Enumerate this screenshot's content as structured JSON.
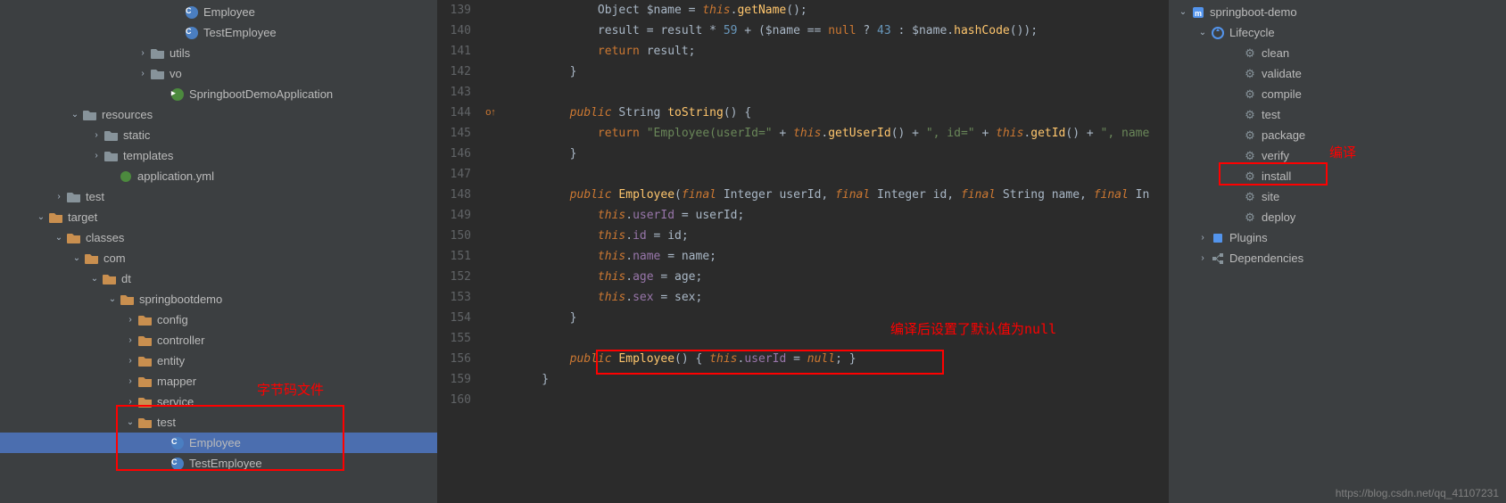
{
  "projectTree": [
    {
      "indent": 190,
      "arrow": "",
      "icon": "class-c",
      "label": "Employee"
    },
    {
      "indent": 190,
      "arrow": "",
      "icon": "class-c",
      "label": "TestEmployee"
    },
    {
      "indent": 152,
      "arrow": "›",
      "icon": "folder",
      "label": "utils"
    },
    {
      "indent": 152,
      "arrow": "›",
      "icon": "folder",
      "label": "vo"
    },
    {
      "indent": 174,
      "arrow": "",
      "icon": "class-g",
      "label": "SpringbootDemoApplication"
    },
    {
      "indent": 76,
      "arrow": "⌄",
      "icon": "folder-res",
      "label": "resources"
    },
    {
      "indent": 100,
      "arrow": "›",
      "icon": "folder",
      "label": "static"
    },
    {
      "indent": 100,
      "arrow": "›",
      "icon": "folder",
      "label": "templates"
    },
    {
      "indent": 116,
      "arrow": "",
      "icon": "yml",
      "label": "application.yml"
    },
    {
      "indent": 58,
      "arrow": "›",
      "icon": "folder",
      "label": "test"
    },
    {
      "indent": 38,
      "arrow": "⌄",
      "icon": "folder-orange",
      "label": "target"
    },
    {
      "indent": 58,
      "arrow": "⌄",
      "icon": "folder-orange",
      "label": "classes"
    },
    {
      "indent": 78,
      "arrow": "⌄",
      "icon": "folder-orange",
      "label": "com"
    },
    {
      "indent": 98,
      "arrow": "⌄",
      "icon": "folder-orange",
      "label": "dt"
    },
    {
      "indent": 118,
      "arrow": "⌄",
      "icon": "folder-orange",
      "label": "springbootdemo"
    },
    {
      "indent": 138,
      "arrow": "›",
      "icon": "folder-orange",
      "label": "config"
    },
    {
      "indent": 138,
      "arrow": "›",
      "icon": "folder-orange",
      "label": "controller"
    },
    {
      "indent": 138,
      "arrow": "›",
      "icon": "folder-orange",
      "label": "entity"
    },
    {
      "indent": 138,
      "arrow": "›",
      "icon": "folder-orange",
      "label": "mapper"
    },
    {
      "indent": 138,
      "arrow": "›",
      "icon": "folder-orange",
      "label": "service"
    },
    {
      "indent": 138,
      "arrow": "⌄",
      "icon": "folder-orange",
      "label": "test"
    },
    {
      "indent": 174,
      "arrow": "",
      "icon": "class-c",
      "label": "Employee",
      "selected": true
    },
    {
      "indent": 174,
      "arrow": "",
      "icon": "class-c",
      "label": "TestEmployee"
    }
  ],
  "code": {
    "lines": [
      {
        "num": "139",
        "tokens": [
          {
            "t": "            Object $name = ",
            "c": ""
          },
          {
            "t": "this",
            "c": "kw"
          },
          {
            "t": ".",
            "c": ""
          },
          {
            "t": "getName",
            "c": "method"
          },
          {
            "t": "();",
            "c": ""
          }
        ]
      },
      {
        "num": "140",
        "tokens": [
          {
            "t": "            result = result * ",
            "c": ""
          },
          {
            "t": "59",
            "c": "num"
          },
          {
            "t": " + ($name == ",
            "c": ""
          },
          {
            "t": "null",
            "c": "kw-n"
          },
          {
            "t": " ? ",
            "c": ""
          },
          {
            "t": "43",
            "c": "num"
          },
          {
            "t": " : $name.",
            "c": ""
          },
          {
            "t": "hashCode",
            "c": "method"
          },
          {
            "t": "());",
            "c": ""
          }
        ]
      },
      {
        "num": "141",
        "tokens": [
          {
            "t": "            ",
            "c": ""
          },
          {
            "t": "return",
            "c": "kw-n"
          },
          {
            "t": " result;",
            "c": ""
          }
        ]
      },
      {
        "num": "142",
        "tokens": [
          {
            "t": "        }",
            "c": ""
          }
        ]
      },
      {
        "num": "143",
        "tokens": [
          {
            "t": "",
            "c": ""
          }
        ]
      },
      {
        "num": "144",
        "gutter": "impl",
        "tokens": [
          {
            "t": "        ",
            "c": ""
          },
          {
            "t": "public",
            "c": "kw"
          },
          {
            "t": " String ",
            "c": ""
          },
          {
            "t": "toString",
            "c": "method"
          },
          {
            "t": "() {",
            "c": ""
          }
        ]
      },
      {
        "num": "145",
        "tokens": [
          {
            "t": "            ",
            "c": ""
          },
          {
            "t": "return",
            "c": "kw-n"
          },
          {
            "t": " ",
            "c": ""
          },
          {
            "t": "\"Employee(userId=\"",
            "c": "str"
          },
          {
            "t": " + ",
            "c": ""
          },
          {
            "t": "this",
            "c": "kw"
          },
          {
            "t": ".",
            "c": ""
          },
          {
            "t": "getUserId",
            "c": "method"
          },
          {
            "t": "() + ",
            "c": ""
          },
          {
            "t": "\", id=\"",
            "c": "str"
          },
          {
            "t": " + ",
            "c": ""
          },
          {
            "t": "this",
            "c": "kw"
          },
          {
            "t": ".",
            "c": ""
          },
          {
            "t": "getId",
            "c": "method"
          },
          {
            "t": "() + ",
            "c": ""
          },
          {
            "t": "\", name",
            "c": "str"
          }
        ]
      },
      {
        "num": "146",
        "tokens": [
          {
            "t": "        }",
            "c": ""
          }
        ]
      },
      {
        "num": "147",
        "tokens": [
          {
            "t": "",
            "c": ""
          }
        ]
      },
      {
        "num": "148",
        "tokens": [
          {
            "t": "        ",
            "c": ""
          },
          {
            "t": "public",
            "c": "kw"
          },
          {
            "t": " ",
            "c": ""
          },
          {
            "t": "Employee",
            "c": "method"
          },
          {
            "t": "(",
            "c": ""
          },
          {
            "t": "final",
            "c": "kw"
          },
          {
            "t": " Integer userId, ",
            "c": ""
          },
          {
            "t": "final",
            "c": "kw"
          },
          {
            "t": " Integer id, ",
            "c": ""
          },
          {
            "t": "final",
            "c": "kw"
          },
          {
            "t": " String name, ",
            "c": ""
          },
          {
            "t": "final",
            "c": "kw"
          },
          {
            "t": " In",
            "c": ""
          }
        ]
      },
      {
        "num": "149",
        "tokens": [
          {
            "t": "            ",
            "c": ""
          },
          {
            "t": "this",
            "c": "kw"
          },
          {
            "t": ".",
            "c": ""
          },
          {
            "t": "userId",
            "c": "field"
          },
          {
            "t": " = userId;",
            "c": ""
          }
        ]
      },
      {
        "num": "150",
        "tokens": [
          {
            "t": "            ",
            "c": ""
          },
          {
            "t": "this",
            "c": "kw"
          },
          {
            "t": ".",
            "c": ""
          },
          {
            "t": "id",
            "c": "field"
          },
          {
            "t": " = id;",
            "c": ""
          }
        ]
      },
      {
        "num": "151",
        "tokens": [
          {
            "t": "            ",
            "c": ""
          },
          {
            "t": "this",
            "c": "kw"
          },
          {
            "t": ".",
            "c": ""
          },
          {
            "t": "name",
            "c": "field"
          },
          {
            "t": " = name;",
            "c": ""
          }
        ]
      },
      {
        "num": "152",
        "tokens": [
          {
            "t": "            ",
            "c": ""
          },
          {
            "t": "this",
            "c": "kw"
          },
          {
            "t": ".",
            "c": ""
          },
          {
            "t": "age",
            "c": "field"
          },
          {
            "t": " = age;",
            "c": ""
          }
        ]
      },
      {
        "num": "153",
        "tokens": [
          {
            "t": "            ",
            "c": ""
          },
          {
            "t": "this",
            "c": "kw"
          },
          {
            "t": ".",
            "c": ""
          },
          {
            "t": "sex",
            "c": "field"
          },
          {
            "t": " = sex;",
            "c": ""
          }
        ]
      },
      {
        "num": "154",
        "tokens": [
          {
            "t": "        }",
            "c": ""
          }
        ]
      },
      {
        "num": "155",
        "tokens": [
          {
            "t": "",
            "c": ""
          }
        ]
      },
      {
        "num": "156",
        "tokens": [
          {
            "t": "        ",
            "c": ""
          },
          {
            "t": "public",
            "c": "kw"
          },
          {
            "t": " ",
            "c": ""
          },
          {
            "t": "Employee",
            "c": "method"
          },
          {
            "t": "() { ",
            "c": ""
          },
          {
            "t": "this",
            "c": "kw"
          },
          {
            "t": ".",
            "c": ""
          },
          {
            "t": "userId",
            "c": "field"
          },
          {
            "t": " = ",
            "c": ""
          },
          {
            "t": "null",
            "c": "kw"
          },
          {
            "t": "; }",
            "c": ""
          }
        ]
      },
      {
        "num": "159",
        "tokens": [
          {
            "t": "    }",
            "c": ""
          }
        ]
      },
      {
        "num": "160",
        "tokens": [
          {
            "t": "",
            "c": ""
          }
        ]
      }
    ]
  },
  "mavenPanel": [
    {
      "indent": 8,
      "arrow": "⌄",
      "icon": "maven",
      "label": "springboot-demo"
    },
    {
      "indent": 30,
      "arrow": "⌄",
      "icon": "lifecycle",
      "label": "Lifecycle"
    },
    {
      "indent": 66,
      "arrow": "",
      "icon": "gear",
      "label": "clean"
    },
    {
      "indent": 66,
      "arrow": "",
      "icon": "gear",
      "label": "validate"
    },
    {
      "indent": 66,
      "arrow": "",
      "icon": "gear",
      "label": "compile"
    },
    {
      "indent": 66,
      "arrow": "",
      "icon": "gear",
      "label": "test"
    },
    {
      "indent": 66,
      "arrow": "",
      "icon": "gear",
      "label": "package"
    },
    {
      "indent": 66,
      "arrow": "",
      "icon": "gear",
      "label": "verify"
    },
    {
      "indent": 66,
      "arrow": "",
      "icon": "gear",
      "label": "install"
    },
    {
      "indent": 66,
      "arrow": "",
      "icon": "gear",
      "label": "site"
    },
    {
      "indent": 66,
      "arrow": "",
      "icon": "gear",
      "label": "deploy"
    },
    {
      "indent": 30,
      "arrow": "›",
      "icon": "plugins",
      "label": "Plugins"
    },
    {
      "indent": 30,
      "arrow": "›",
      "icon": "deps",
      "label": "Dependencies"
    }
  ],
  "annotations": {
    "bytecode": "字节码文件",
    "nullDefault": "编译后设置了默认值为null",
    "compile": "编译"
  },
  "watermark": "https://blog.csdn.net/qq_41107231"
}
